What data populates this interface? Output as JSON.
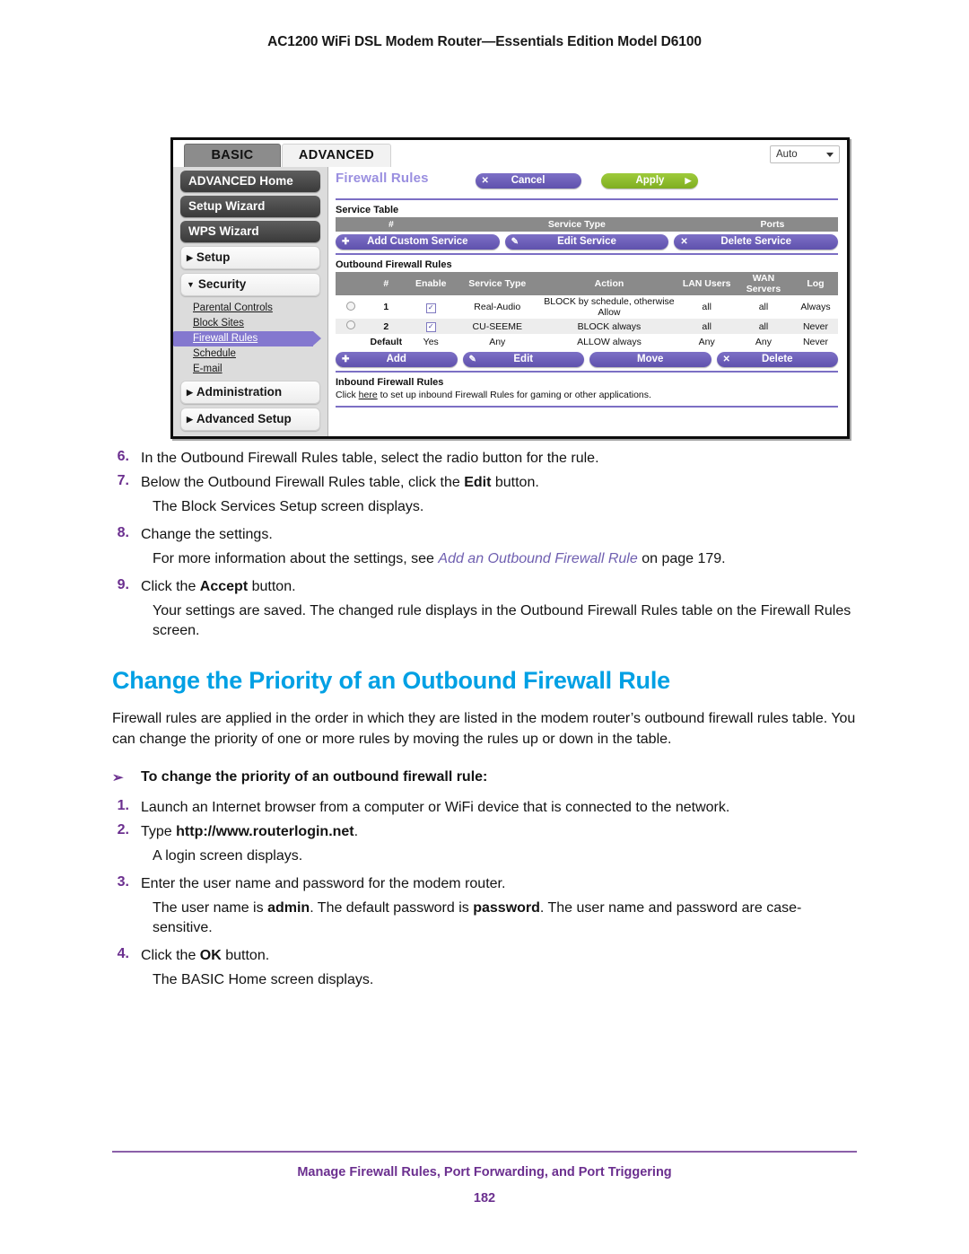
{
  "header": {
    "title": "AC1200 WiFi DSL Modem Router—Essentials Edition Model D6100"
  },
  "figure": {
    "tabs": {
      "basic": "BASIC",
      "advanced": "ADVANCED"
    },
    "language_select": {
      "value": "Auto"
    },
    "nav_buttons": [
      "ADVANCED Home",
      "Setup Wizard",
      "WPS Wizard"
    ],
    "nav_sections": [
      {
        "label": "Setup",
        "state": "collapsed"
      },
      {
        "label": "Security",
        "state": "expanded"
      },
      {
        "label": "Administration",
        "state": "collapsed"
      },
      {
        "label": "Advanced Setup",
        "state": "collapsed"
      }
    ],
    "security_items": [
      {
        "label": "Parental Controls",
        "active": false
      },
      {
        "label": "Block Sites",
        "active": false
      },
      {
        "label": "Firewall Rules",
        "active": true
      },
      {
        "label": "Schedule",
        "active": false
      },
      {
        "label": "E-mail",
        "active": false
      }
    ],
    "page_title": "Firewall Rules",
    "top_buttons": {
      "cancel": "Cancel",
      "apply": "Apply"
    },
    "service_table": {
      "label": "Service Table",
      "columns": [
        "#",
        "Service Type",
        "Ports"
      ],
      "rows": [],
      "buttons": [
        "Add Custom Service",
        "Edit Service",
        "Delete Service"
      ]
    },
    "outbound_rules": {
      "label": "Outbound Firewall Rules",
      "columns": [
        "",
        "#",
        "Enable",
        "Service Type",
        "Action",
        "LAN Users",
        "WAN Servers",
        "Log"
      ],
      "rows": [
        {
          "select": "radio",
          "num": "1",
          "enable": "checked",
          "service_type": "Real-Audio",
          "action": "BLOCK by schedule, otherwise Allow",
          "lan_users": "all",
          "wan_servers": "all",
          "log": "Always"
        },
        {
          "select": "radio",
          "num": "2",
          "enable": "checked",
          "service_type": "CU-SEEME",
          "action": "BLOCK always",
          "lan_users": "all",
          "wan_servers": "all",
          "log": "Never"
        },
        {
          "select": "none",
          "num": "Default",
          "enable": "Yes",
          "service_type": "Any",
          "action": "ALLOW always",
          "lan_users": "Any",
          "wan_servers": "Any",
          "log": "Never"
        }
      ],
      "buttons": [
        "Add",
        "Edit",
        "Move",
        "Delete"
      ]
    },
    "inbound_rules": {
      "label": "Inbound Firewall Rules",
      "note_before": "Click ",
      "note_link": "here",
      "note_after": " to set up inbound Firewall Rules for gaming or other applications."
    }
  },
  "body": {
    "steps_top": [
      {
        "num": "6.",
        "text": "In the Outbound Firewall Rules table, select the radio button for the rule."
      },
      {
        "num": "7.",
        "pre": "Below the Outbound Firewall Rules table, click the ",
        "bold": "Edit",
        "post": " button."
      }
    ],
    "para_block_services": "The Block Services Setup screen displays.",
    "step_8": {
      "num": "8.",
      "text": "Change the settings."
    },
    "para_more_info": {
      "pre": "For more information about the settings, see ",
      "xref": "Add an Outbound Firewall Rule",
      "post": " on page 179."
    },
    "step_9": {
      "num": "9.",
      "pre": "Click the ",
      "bold": "Accept",
      "post": " button."
    },
    "para_saved": "Your settings are saved. The changed rule displays in the Outbound Firewall Rules table on the Firewall Rules screen.",
    "section_heading": "Change the Priority of an Outbound Firewall Rule",
    "intro": "Firewall rules are applied in the order in which they are listed in the modem router’s outbound firewall rules table. You can change the priority of one or more rules by moving the rules up or down in the table.",
    "procedure_heading": "To change the priority of an outbound firewall rule:",
    "procedure_arrow": "➢",
    "steps_bottom": [
      {
        "num": "1.",
        "text": "Launch an Internet browser from a computer or WiFi device that is connected to the network."
      },
      {
        "num": "2.",
        "pre": "Type ",
        "bold": "http://www.routerlogin.net",
        "post": "."
      }
    ],
    "para_login": "A login screen displays.",
    "step_3": {
      "num": "3.",
      "text": "Enter the user name and password for the modem router."
    },
    "para_creds": {
      "p1": "The user name is ",
      "b1": "admin",
      "p2": ". The default password is ",
      "b2": "password",
      "p3": ". The user name and password are case-sensitive."
    },
    "step_4": {
      "num": "4.",
      "pre": "Click the ",
      "bold": "OK",
      "post": " button."
    },
    "para_basic_home": "The BASIC Home screen displays."
  },
  "footer": {
    "chapter": "Manage Firewall Rules, Port Forwarding, and Port Triggering",
    "page_number": "182"
  },
  "colors": {
    "heading_blue": "#00a0e4",
    "step_purple": "#6b2f8f",
    "xref_purple": "#6f5fb0",
    "footer_purple": "#6b2f8f",
    "ui_purple": "#7c6fc4",
    "ui_green": "#8fbd2d"
  }
}
